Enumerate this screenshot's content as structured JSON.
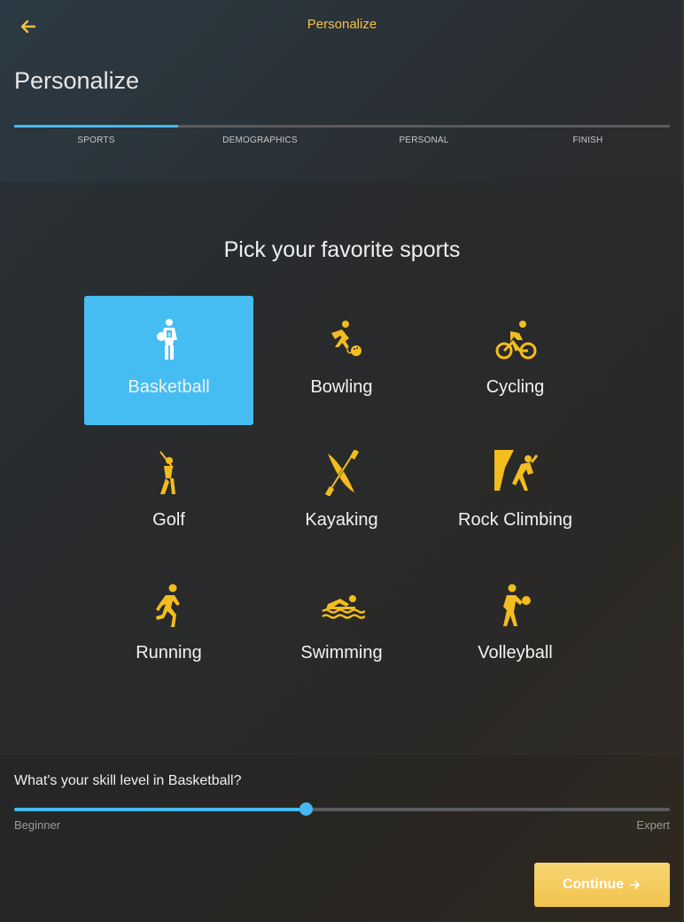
{
  "header": {
    "back_icon": "arrow-left-icon",
    "title": "Personalize"
  },
  "page_title": "Personalize",
  "steps": {
    "progress": 0.25,
    "items": [
      {
        "label": "SPORTS",
        "active": true
      },
      {
        "label": "DEMOGRAPHICS",
        "active": false
      },
      {
        "label": "PERSONAL",
        "active": false
      },
      {
        "label": "FINISH",
        "active": false
      }
    ]
  },
  "heading": "Pick your favorite sports",
  "sports": [
    {
      "label": "Basketball",
      "icon": "basketball-player-icon",
      "selected": true
    },
    {
      "label": "Bowling",
      "icon": "bowling-icon",
      "selected": false
    },
    {
      "label": "Cycling",
      "icon": "cycling-icon",
      "selected": false
    },
    {
      "label": "Golf",
      "icon": "golf-icon",
      "selected": false
    },
    {
      "label": "Kayaking",
      "icon": "kayak-paddle-icon",
      "selected": false
    },
    {
      "label": "Rock Climbing",
      "icon": "rock-climbing-icon",
      "selected": false
    },
    {
      "label": "Running",
      "icon": "running-icon",
      "selected": false
    },
    {
      "label": "Swimming",
      "icon": "swimming-icon",
      "selected": false
    },
    {
      "label": "Volleyball",
      "icon": "volleyball-icon",
      "selected": false
    }
  ],
  "skill": {
    "question": "What's your skill level in Basketball?",
    "value": 0.445,
    "min_label": "Beginner",
    "max_label": "Expert"
  },
  "continue": {
    "label": "Continue",
    "icon": "arrow-right-icon"
  },
  "colors": {
    "accent_yellow": "#f5c242",
    "accent_blue": "#45bdf3",
    "icon_yellow": "#f3bd1f"
  }
}
